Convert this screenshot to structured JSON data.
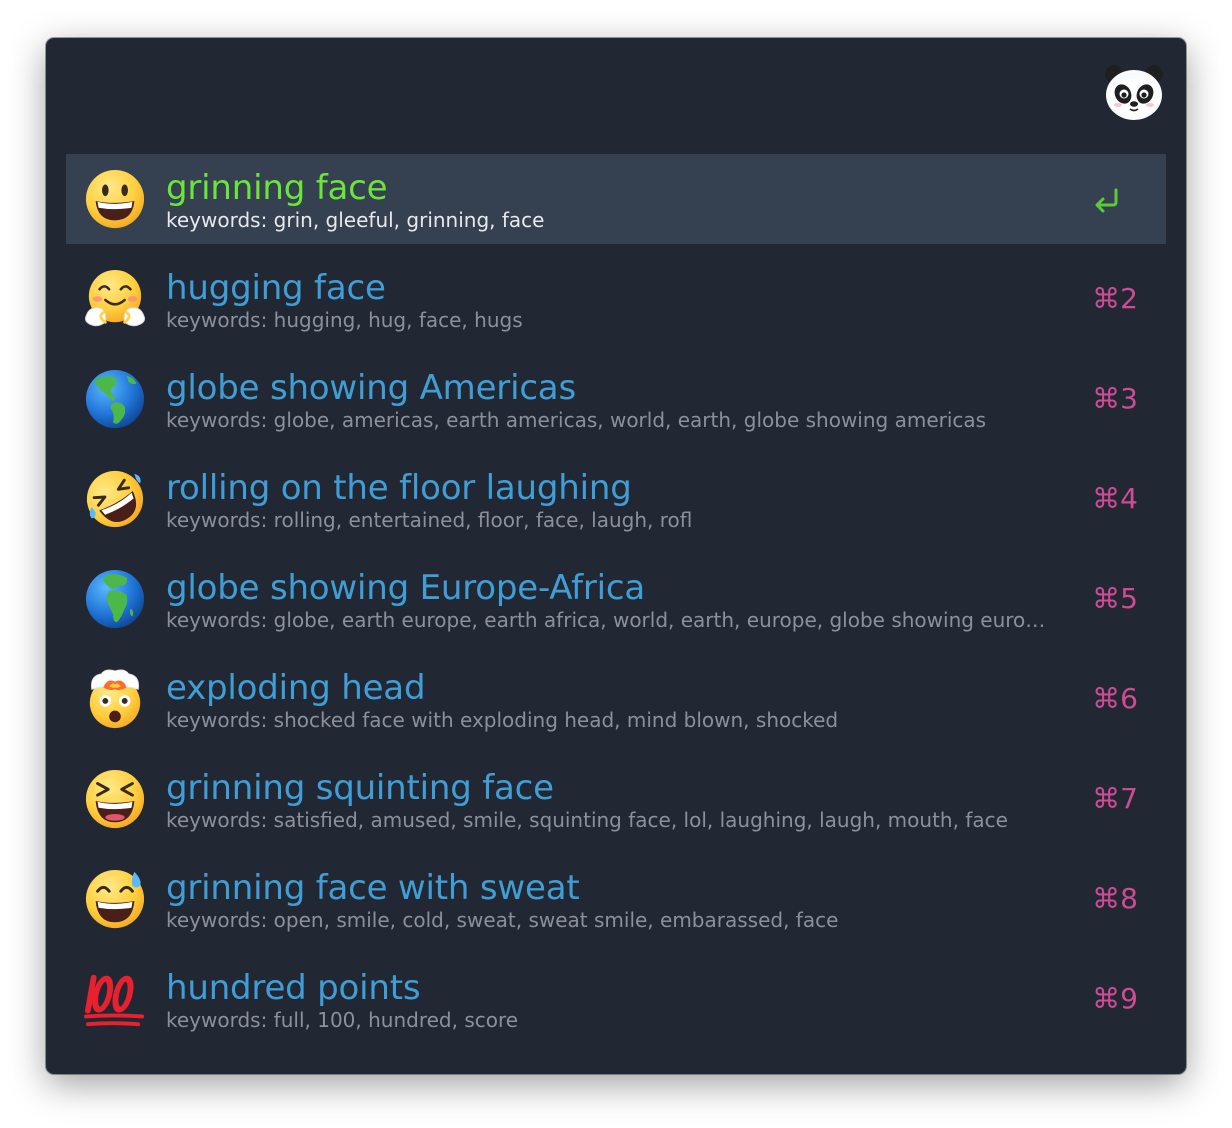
{
  "search": {
    "value": "",
    "placeholder": ""
  },
  "app_icon": "panda-icon",
  "results": [
    {
      "icon": "grinning-face-icon",
      "title": "grinning face",
      "subtitle": "keywords: grin, gleeful, grinning, face",
      "shortcut": "",
      "selected": true
    },
    {
      "icon": "hugging-face-icon",
      "title": "hugging face",
      "subtitle": "keywords: hugging, hug, face, hugs",
      "shortcut": "⌘2"
    },
    {
      "icon": "globe-americas-icon",
      "title": "globe showing Americas",
      "subtitle": "keywords: globe, americas, earth americas, world, earth, globe showing americas",
      "shortcut": "⌘3"
    },
    {
      "icon": "rofl-icon",
      "title": "rolling on the floor laughing",
      "subtitle": "keywords: rolling, entertained, floor, face, laugh, rofl",
      "shortcut": "⌘4"
    },
    {
      "icon": "globe-europe-africa-icon",
      "title": "globe showing Europe-Africa",
      "subtitle": "keywords: globe, earth europe, earth africa, world, earth, europe, globe showing euro…",
      "shortcut": "⌘5"
    },
    {
      "icon": "exploding-head-icon",
      "title": "exploding head",
      "subtitle": "keywords: shocked face with exploding head, mind blown, shocked",
      "shortcut": "⌘6"
    },
    {
      "icon": "grinning-squinting-face-icon",
      "title": "grinning squinting face",
      "subtitle": "keywords: satisfied, amused, smile, squinting face, lol, laughing, laugh, mouth, face",
      "shortcut": "⌘7"
    },
    {
      "icon": "grinning-face-with-sweat-icon",
      "title": "grinning face with sweat",
      "subtitle": "keywords: open, smile, cold, sweat, sweat smile, embarassed, face",
      "shortcut": "⌘8"
    },
    {
      "icon": "hundred-points-icon",
      "title": "hundred points",
      "subtitle": "keywords: full, 100, hundred, score",
      "shortcut": "⌘9"
    }
  ],
  "colors": {
    "window_background": "#222833",
    "selected_row_background": "#354150",
    "selected_title": "#6be53a",
    "title": "#3f9ed6",
    "subtitle": "#8a919c",
    "selected_subtitle": "#e6e9ed",
    "shortcut": "#cf4b94",
    "enter_icon": "#5ccb3a"
  }
}
